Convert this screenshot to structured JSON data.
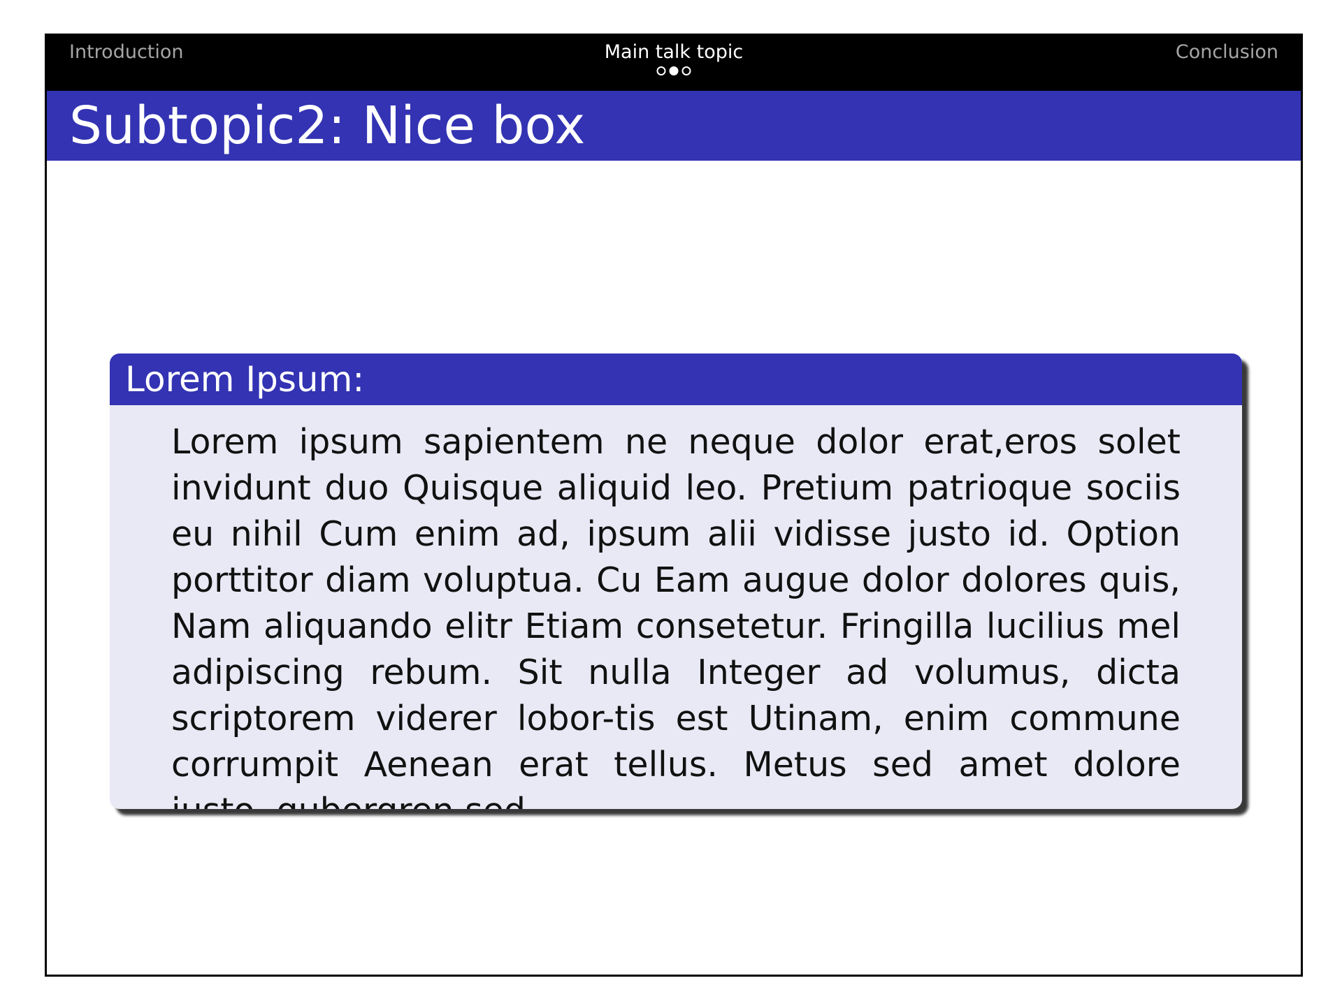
{
  "navigation": {
    "left_section": "Introduction",
    "current_section": "Main talk topic",
    "right_section": "Conclusion",
    "subsection_dots": [
      "empty",
      "filled",
      "empty"
    ]
  },
  "slide": {
    "title": "Subtopic2: Nice box"
  },
  "block": {
    "title": "Lorem Ipsum:",
    "body": "Lorem ipsum sapientem ne neque dolor erat,eros solet invidunt duo Quisque aliquid leo. Pretium patrioque sociis eu nihil Cum enim ad, ipsum alii vidisse justo id. Option porttitor diam voluptua. Cu Eam augue dolor dolores quis, Nam aliquando elitr Etiam consetetur. Fringilla lucilius mel adipiscing rebum. Sit nulla Integer ad volumus, dicta scriptorem viderer lobor-tis est Utinam, enim commune corrumpit Aenean erat tellus. Metus sed amet dolore justo, gubergren sed."
  },
  "colors": {
    "accent": "#3333b3",
    "block_background": "#e9e9f6",
    "navbar": "#000000"
  }
}
